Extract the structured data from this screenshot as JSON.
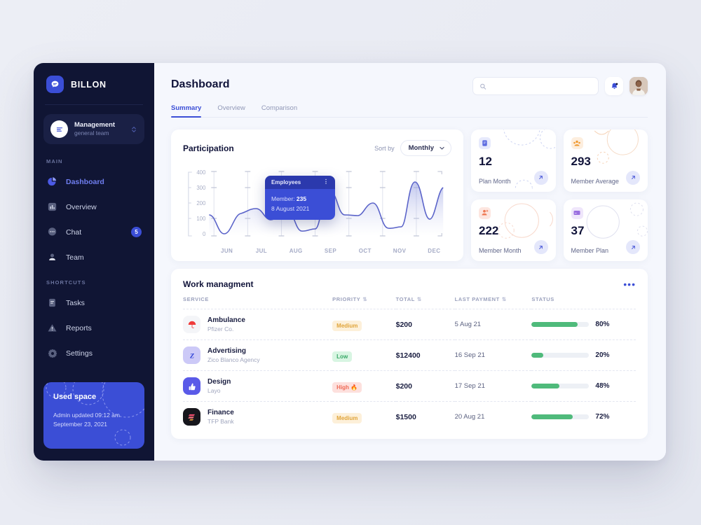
{
  "sidebar": {
    "brand": {
      "name": "BILLON",
      "logo_icon": "chat-bubble-icon"
    },
    "team": {
      "name": "Management",
      "subtitle": "general team",
      "selector_icon": "chevron-updown-icon"
    },
    "section_main": "MAIN",
    "section_shortcuts": "SHORTCUTS",
    "main_items": [
      {
        "label": "Dashboard",
        "icon": "pie-chart-icon",
        "active": true,
        "badge": ""
      },
      {
        "label": "Overview",
        "icon": "bar-chart-icon",
        "active": false,
        "badge": ""
      },
      {
        "label": "Chat",
        "icon": "chat-dots-icon",
        "active": false,
        "badge": "5"
      },
      {
        "label": "Team",
        "icon": "person-icon",
        "active": false,
        "badge": ""
      }
    ],
    "shortcut_items": [
      {
        "label": "Tasks",
        "icon": "document-icon",
        "active": false,
        "badge": ""
      },
      {
        "label": "Reports",
        "icon": "warning-triangle-icon",
        "active": false,
        "badge": ""
      },
      {
        "label": "Settings",
        "icon": "gear-icon",
        "active": false,
        "badge": ""
      }
    ],
    "used_space": {
      "title": "Used space",
      "line1": "Admin updated 09:12 am",
      "line2": "September 23, 2021"
    }
  },
  "header": {
    "title": "Dashboard",
    "search_placeholder": "",
    "search_value": "",
    "search_icon": "search-icon",
    "bell_icon": "bell-icon",
    "avatar_name": "user-avatar",
    "tabs": [
      {
        "label": "Summary",
        "active": true
      },
      {
        "label": "Overview",
        "active": false
      },
      {
        "label": "Comparison",
        "active": false
      }
    ]
  },
  "chart_card": {
    "title": "Participation",
    "sort_label": "Sort by",
    "sort_value": "Monthly",
    "sort_options": [
      "Monthly"
    ],
    "tooltip": {
      "header": "Employees",
      "menu_icon": "vertical-dots-icon",
      "member_label": "Member:",
      "member_value": "235",
      "date": "8 August 2021"
    }
  },
  "chart_data": {
    "type": "area",
    "title": "Participation",
    "xlabel": "",
    "ylabel": "",
    "ylim": [
      0,
      400
    ],
    "yticks": [
      0,
      100,
      200,
      300,
      400
    ],
    "categories": [
      "JUN",
      "JUL",
      "AUG",
      "SEP",
      "OCT",
      "NOV",
      "DEC"
    ],
    "grid": true,
    "legend": false,
    "series": [
      {
        "name": "Members",
        "color": "#5a63c9",
        "x": [
          0,
          0.3,
          0.6,
          1.0,
          1.35,
          1.7,
          2.0,
          2.3,
          2.6,
          3.0,
          3.3,
          3.6,
          4.0,
          4.35,
          4.7,
          5.0,
          5.3,
          5.6,
          6.0,
          6.3
        ],
        "values": [
          135,
          25,
          140,
          168,
          110,
          170,
          45,
          40,
          290,
          135,
          130,
          215,
          120,
          55,
          350,
          270,
          150,
          150,
          290,
          290
        ]
      }
    ],
    "highlight": {
      "label": "Employees",
      "member": 235,
      "date": "8 August 2021"
    }
  },
  "stats": [
    {
      "value": "12",
      "label": "Plan Month",
      "icon": "document-stat-icon",
      "icon_bg": "#e7eafc",
      "icon_color": "#5b6ae0",
      "arrow_icon": "arrow-up-right-icon"
    },
    {
      "value": "293",
      "label": "Member Average",
      "icon": "group-stat-icon",
      "icon_bg": "#fdeede",
      "icon_color": "#f0992f",
      "arrow_icon": "arrow-up-right-icon"
    },
    {
      "value": "222",
      "label": "Member Month",
      "icon": "add-person-icon",
      "icon_bg": "#fde6e0",
      "icon_color": "#ef7a55",
      "arrow_icon": "arrow-up-right-icon"
    },
    {
      "value": "37",
      "label": "Member Plan",
      "icon": "card-stat-icon",
      "icon_bg": "#efe6fb",
      "icon_color": "#9a6fe0",
      "arrow_icon": "arrow-up-right-icon"
    }
  ],
  "table": {
    "title": "Work managment",
    "menu_icon": "horizontal-dots-icon",
    "columns": [
      {
        "label": "SERVICE",
        "sortable": false
      },
      {
        "label": "PRIORITY",
        "sortable": true
      },
      {
        "label": "TOTAL",
        "sortable": true
      },
      {
        "label": "LAST PAYMENT",
        "sortable": true
      },
      {
        "label": "STATUS",
        "sortable": false
      }
    ],
    "rows": [
      {
        "service": "Ambulance",
        "company": "Pfizer Co.",
        "icon": "umbrella-icon",
        "icon_bg": "#f4f5f8",
        "priority": "Medium",
        "priority_class": "p-medium",
        "total": "$200",
        "last_payment": "5 Aug 21",
        "percent": "80%",
        "pct_value": 80
      },
      {
        "service": "Advertising",
        "company": "Zico Blanco Agency",
        "icon": "letter-z-icon",
        "icon_bg": "#ccc9f7",
        "priority": "Low",
        "priority_class": "p-low",
        "total": "$12400",
        "last_payment": "16 Sep 21",
        "percent": "20%",
        "pct_value": 20
      },
      {
        "service": "Design",
        "company": "Layo",
        "icon": "thumb-up-icon",
        "icon_bg": "#5a5ae8",
        "priority": "High 🔥",
        "priority_class": "p-high",
        "total": "$200",
        "last_payment": "17 Sep 21",
        "percent": "48%",
        "pct_value": 48
      },
      {
        "service": "Finance",
        "company": "TFP Bank",
        "icon": "stripes-icon",
        "icon_bg": "#16161c",
        "priority": "Medium",
        "priority_class": "p-medium",
        "total": "$1500",
        "last_payment": "20 Aug 21",
        "percent": "72%",
        "pct_value": 72
      }
    ]
  },
  "colors": {
    "accent": "#3b4ed6",
    "sidebar_bg": "#101534",
    "progress": "#4fba7b",
    "chart_line": "#5a63c9"
  }
}
